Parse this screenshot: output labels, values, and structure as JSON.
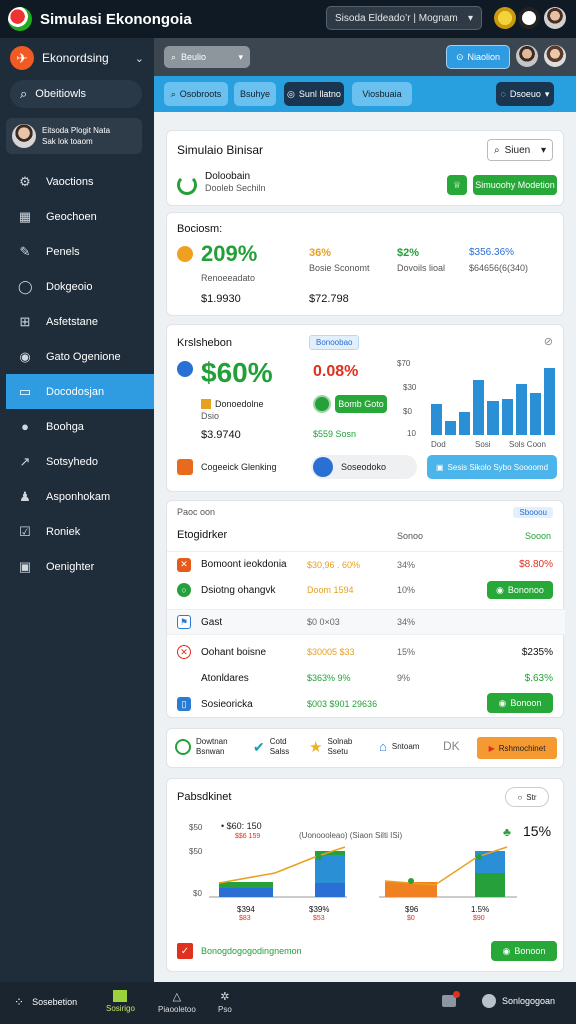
{
  "app": {
    "title": "Simulasi Ekonongoia"
  },
  "titlebar": {
    "search_text": "Sisoda Eldeado’r | Mognam"
  },
  "sidebar": {
    "brand": "Ekonordsing",
    "search_label": "Obeitiowls",
    "user": {
      "line1": "Eitsoda Plogit Nata",
      "line2": "Sak lok toaom"
    },
    "items": [
      {
        "label": "Vaoctions",
        "icon": "gear-icon"
      },
      {
        "label": "Geochoen",
        "icon": "calculator-icon"
      },
      {
        "label": "Penels",
        "icon": "pen-icon"
      },
      {
        "label": "Dokgeoio",
        "icon": "chat-icon"
      },
      {
        "label": "Asfetstane",
        "icon": "grid-icon"
      },
      {
        "label": "Gato Ogenione",
        "icon": "globe-icon"
      },
      {
        "label": "Docodosjan",
        "icon": "folder-icon"
      },
      {
        "label": "Boohga",
        "icon": "person-icon"
      },
      {
        "label": "Sotsyhedo",
        "icon": "wrench-icon"
      },
      {
        "label": "Asponhokam",
        "icon": "user-icon"
      },
      {
        "label": "Roniek",
        "icon": "check-icon"
      },
      {
        "label": "Oenighter",
        "icon": "image-icon"
      }
    ]
  },
  "topbar": {
    "pill": "Beulio",
    "blue_btn": "Niaolion"
  },
  "filters": {
    "a": "Osobroots",
    "b": "Bsuhye",
    "c": "Sunl llatno",
    "d": "Viosbuaia",
    "e": "Dsoeuo"
  },
  "sim": {
    "title": "Simulaio Binisar",
    "dropdown": "Siuen",
    "sub_title": "Doloobain",
    "sub_line": "Dooleb Sechiln",
    "button": "Simuoohy Modetion"
  },
  "budget": {
    "label": "Bociosm:",
    "main_pct": "209%",
    "main_sub": "Renoeeadato",
    "main_val": "$1.9930",
    "c1_pct": "36%",
    "c1_sub": "Bosie Sconomt",
    "c1_val": "$72.798",
    "c2_pct": "$2%",
    "c2_sub": "Dovoils  lioal",
    "c3_pct": "$356.36%",
    "c3_sub": "$64656(6(340)"
  },
  "kpi": {
    "title": "Krslshebon",
    "tag": "Bonoobao",
    "big": "$60%",
    "red": "0.08%",
    "legend1": "Donoedolne",
    "legend2": "Dsio",
    "val": "$3.9740",
    "btn_green": "Bomb Goto",
    "green_label": "$559 Sosn",
    "axis_top": "$70",
    "axis_mid": "$30",
    "axis_low": "$0",
    "axis_zero": "10",
    "x1": "Dod",
    "x2": "Sosi",
    "x3": "Sols Coon",
    "bars": [
      40,
      18,
      30,
      70,
      44,
      46,
      66,
      54,
      86
    ],
    "footer1": "Cogeeick Glenking",
    "footer2": "Soseodoko",
    "footer3": "Sesis Sikolo Sybo Soooomd",
    "bar_color": "#2a8fd4"
  },
  "table": {
    "label": "Paoc oon",
    "tag": "Sbooou",
    "header": {
      "name": "Etogidrker",
      "mid": "Sonoo",
      "right": "Sooon"
    },
    "rows": [
      {
        "name": "Bomoont ieokdonia",
        "mid": "$30,96 . 60%",
        "pct": "34%",
        "right": "$8.80%",
        "icon_color": "#e45b1c",
        "mid_color": "#e8a020",
        "right_color": "#e0301e"
      },
      {
        "name": "Dsiotng ohangvk",
        "mid": "Doom 1594",
        "pct": "10%",
        "right": "Bononoo",
        "icon_color": "#26a03a",
        "mid_color": "#e8a020",
        "right_color": "#ffffff",
        "button": true
      },
      {
        "name": "Gast",
        "mid": "$0  0×03",
        "pct": "34%",
        "right": "",
        "icon_color": "#2a7bd4",
        "mid_color": "#666666",
        "right_color": "#111111"
      },
      {
        "name": "Oohant boisne",
        "mid": "$30005 $33",
        "pct": "15%",
        "right": "$235%",
        "icon_color": "#e0301e",
        "mid_color": "#e8a020",
        "right_color": "#111111"
      },
      {
        "name": "Atonldares",
        "mid": "$363% 9%",
        "pct": "9%",
        "right": "$.63%",
        "icon_color": "",
        "mid_color": "#26a03a",
        "right_color": "#26a03a"
      },
      {
        "name": "Sosieoricka",
        "mid": "$003 $901 29636",
        "pct": "",
        "right": "Bonoon",
        "icon_color": "#2a7bd4",
        "mid_color": "#26a03a",
        "right_color": "#ffffff",
        "button": true
      }
    ]
  },
  "strip": {
    "a1": "Dowtnan",
    "a2": "Bsnwan",
    "b1": "Cotd",
    "b2": "Salss",
    "c1": "Solnab",
    "c2": "Ssetu",
    "d1": "Sntoam",
    "e1": "DK",
    "btn": "Rshmochinet"
  },
  "perf": {
    "title": "Pabsdkinet",
    "dropdown": "Str",
    "legend_top": "• $60: 150",
    "legend_sub": "$$6 159",
    "note": "(Uonoooleao) (Siaon Silti ISi)",
    "pct": "15%",
    "y1": "$50",
    "y2": "$50",
    "y3": "$0",
    "x1": "$394",
    "x1b": "$83",
    "x2": "$39%",
    "x2b": "$53",
    "x3": "$96",
    "x3b": "$0",
    "x4": "1.5%",
    "x4b": "$90",
    "footer": "Bonogdogogodingnemon",
    "btn": "Bonoon"
  },
  "bottom": {
    "left": "Sosebetion",
    "t1": "Sosirigo",
    "t2": "Piaooletoo",
    "t3": "Pso",
    "right": "Sonlogogoan"
  }
}
